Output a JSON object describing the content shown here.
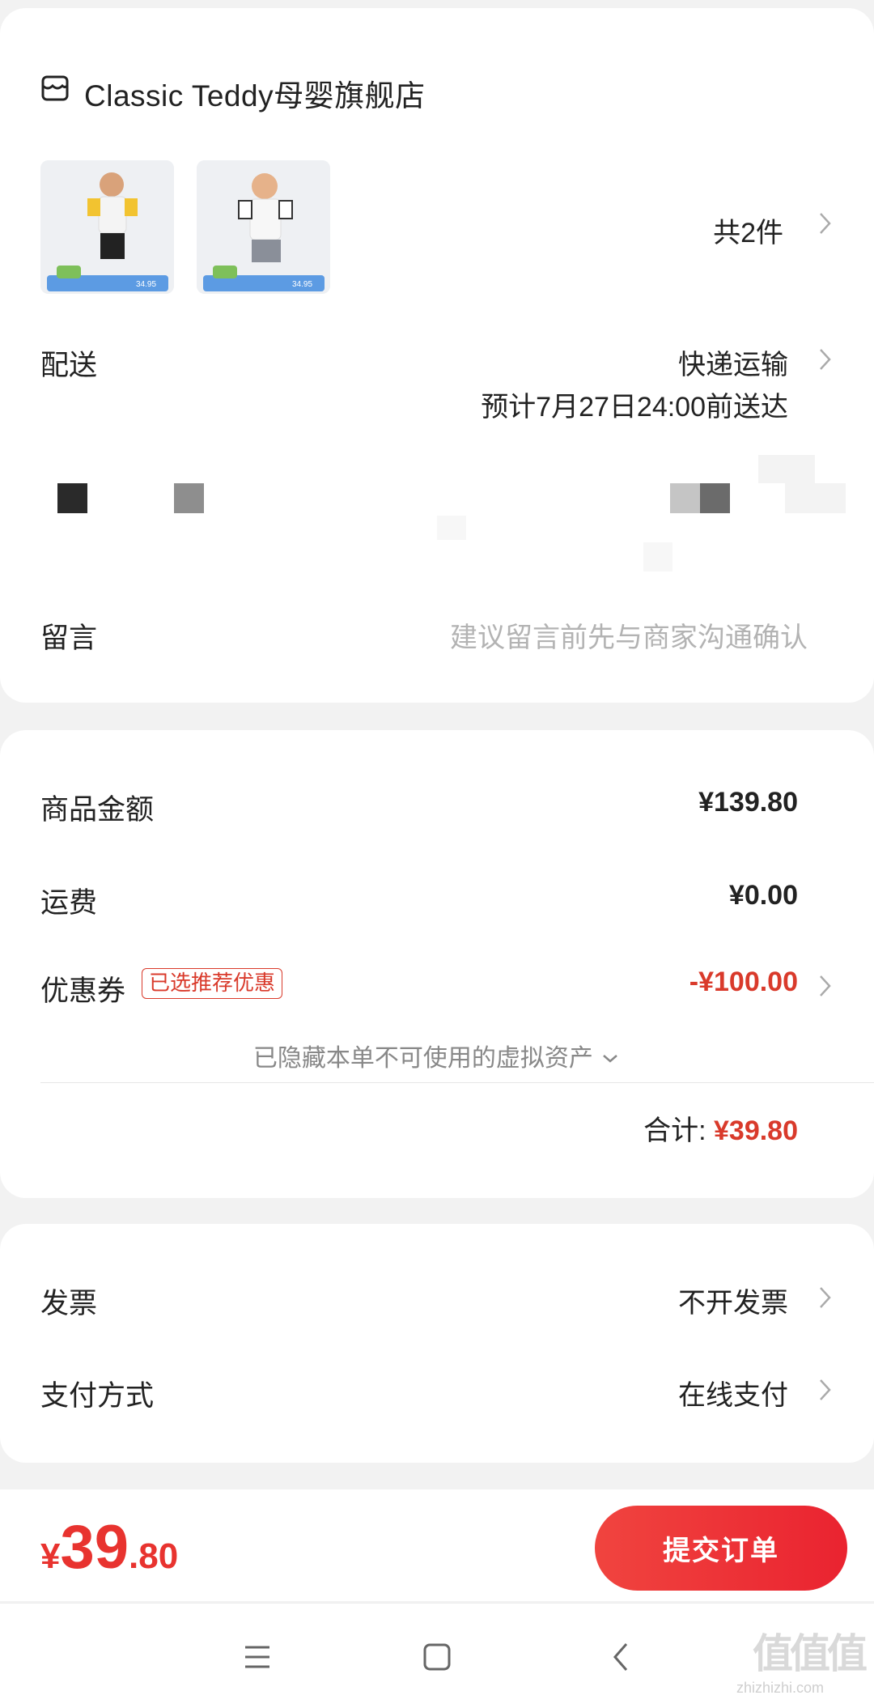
{
  "store": {
    "name": "Classic Teddy母婴旗舰店",
    "icon": "store-icon"
  },
  "items": {
    "count_label": "共2件",
    "thumbnails": [
      {
        "alt": "product-image",
        "badge_price": "34.95"
      },
      {
        "alt": "product-image",
        "badge_price": "34.95"
      }
    ]
  },
  "delivery": {
    "label": "配送",
    "method": "快递运输",
    "eta": "预计7月27日24:00前送达"
  },
  "note": {
    "label": "留言",
    "placeholder": "建议留言前先与商家沟通确认"
  },
  "summary": {
    "goods_label": "商品金额",
    "goods_value": "¥139.80",
    "shipping_label": "运费",
    "shipping_value": "¥0.00",
    "coupon_label": "优惠券",
    "coupon_tag": "已选推荐优惠",
    "coupon_value": "-¥100.00",
    "hidden_assets": "已隐藏本单不可使用的虚拟资产",
    "total_label": "合计:",
    "total_value": "¥39.80"
  },
  "invoice": {
    "label": "发票",
    "value": "不开发票"
  },
  "payment": {
    "label": "支付方式",
    "value": "在线支付"
  },
  "checkout": {
    "currency": "¥",
    "price_int": "39",
    "price_dec": ".80",
    "submit_label": "提交订单"
  },
  "colors": {
    "accent": "#e8332f",
    "price_red": "#d93a2b"
  },
  "watermark": {
    "text": "值值值",
    "subtext": "zhizhizhi.com"
  }
}
